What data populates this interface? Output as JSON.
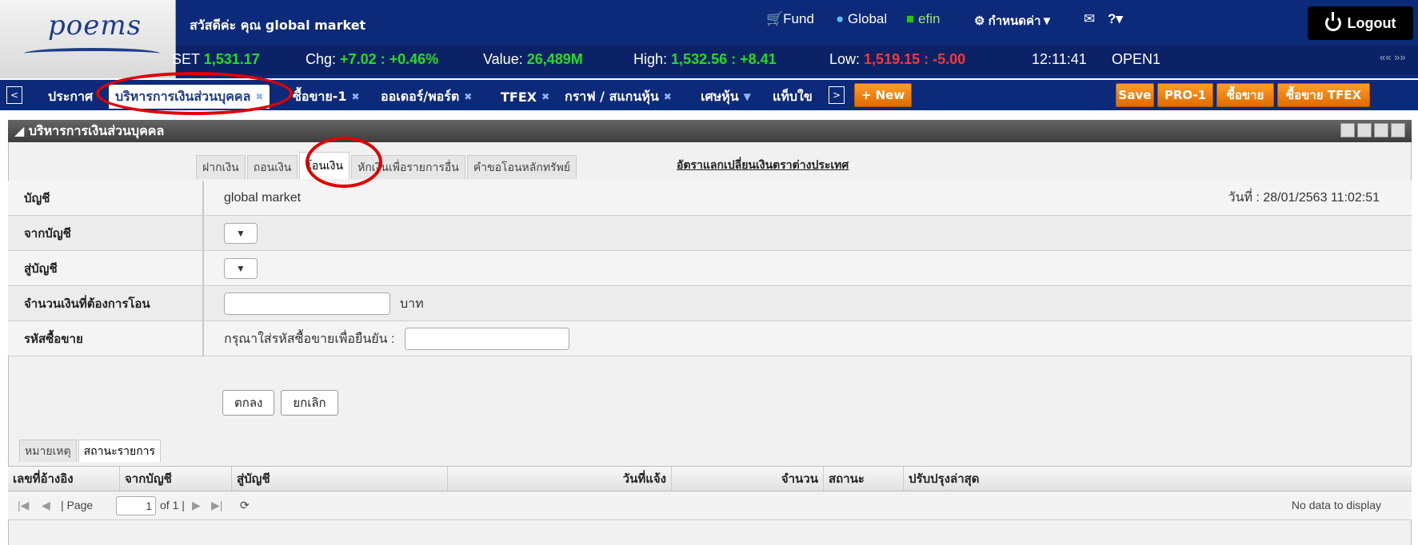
{
  "header": {
    "logo": "poems",
    "greeting": "สวัสดีค่ะ คุณ global market",
    "links": {
      "fund": "Fund",
      "global": "Global",
      "efin": "efin",
      "settings": "กำหนดค่า▼",
      "help": "?▾"
    },
    "logout": "Logout"
  },
  "ticker": {
    "set_label": "SET",
    "set_value": "1,531.17",
    "chg_label": "Chg:",
    "chg_value": "+7.02 : +0.46%",
    "value_label": "Value:",
    "value_value": "26,489M",
    "high_label": "High:",
    "high_value": "1,532.56 : +8.41",
    "low_label": "Low:",
    "low_value": "1,519.15 : -5.00",
    "time": "12:11:41",
    "status": "OPEN1",
    "scroll": "«« »»"
  },
  "tabs": [
    {
      "label": "ประกาศ"
    },
    {
      "label": "บริหารการเงินส่วนบุคคล"
    },
    {
      "label": "ซื้อขาย-1"
    },
    {
      "label": "ออเดอร์/พอร์ต"
    },
    {
      "label": "TFEX"
    },
    {
      "label": "กราฟ / สแกนหุ้น"
    },
    {
      "label": "เศษหุ้น"
    },
    {
      "label": "แท็บใข"
    }
  ],
  "toolbar": {
    "new": "+ New",
    "save": "Save",
    "pro1": "PRO-1",
    "buysell": "ซื้อขาย",
    "buysell_tfex": "ซื้อขาย TFEX"
  },
  "panel": {
    "title": "◢ บริหารการเงินส่วนบุคคล"
  },
  "subtabs": [
    "ฝากเงิน",
    "ถอนเงิน",
    "โอนเงิน",
    "หักเงินเพื่อรายการอื่น",
    "คำขอโอนหลักทรัพย์"
  ],
  "fx_link": "อัตราแลกเปลี่ยนเงินตราต่างประเทศ",
  "form": {
    "account_label": "บัญชี",
    "account_value": "global market",
    "date": "วันที่ : 28/01/2563 11:02:51",
    "from_label": "จากบัญชี",
    "to_label": "สู่บัญชี",
    "amount_label": "จำนวนเงินที่ต้องการโอน",
    "amount_unit": "บาท",
    "pin_label": "รหัสซื้อขาย",
    "pin_prompt": "กรุณาใส่รหัสซื้อขายเพื่อยืนยัน :",
    "ok": "ตกลง",
    "cancel": "ยกเลิก"
  },
  "bottom_tabs": [
    "หมายเหตุ",
    "สถานะรายการ"
  ],
  "table": {
    "columns": [
      "เลขที่อ้างอิง",
      "จากบัญชี",
      "สู่บัญชี",
      "วันที่แจ้ง",
      "จำนวน",
      "สถานะ",
      "ปรับปรุงล่าสุด"
    ]
  },
  "pager": {
    "page_label": "| Page",
    "page_value": "1",
    "of": "of 1 |",
    "empty": "No data to display"
  }
}
